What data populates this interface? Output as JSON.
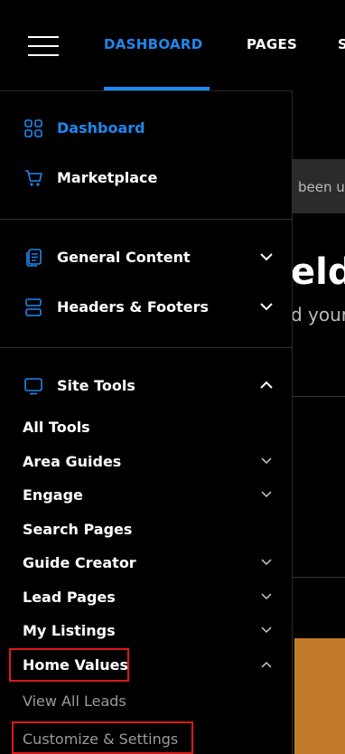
{
  "topbar": {
    "nav": [
      {
        "label": "DASHBOARD",
        "active": true
      },
      {
        "label": "PAGES",
        "active": false
      },
      {
        "label": "S",
        "active": false
      }
    ]
  },
  "page_peek": {
    "banner_text": "been u",
    "heading": "elde",
    "subheading": "d your"
  },
  "sidebar": {
    "top": [
      {
        "label": "Dashboard",
        "icon": "grid-icon",
        "active": true
      },
      {
        "label": "Marketplace",
        "icon": "cart-icon",
        "active": false
      }
    ],
    "content": [
      {
        "label": "General Content",
        "icon": "documents-icon",
        "expanded": false
      },
      {
        "label": "Headers & Footers",
        "icon": "layout-icon",
        "expanded": false
      }
    ],
    "tools": {
      "label": "Site Tools",
      "icon": "monitor-icon",
      "expanded": true
    },
    "sub_items": [
      {
        "label": "All Tools",
        "chevron": "none"
      },
      {
        "label": "Area Guides",
        "chevron": "down"
      },
      {
        "label": "Engage",
        "chevron": "down"
      },
      {
        "label": "Search Pages",
        "chevron": "none"
      },
      {
        "label": "Guide Creator",
        "chevron": "down"
      },
      {
        "label": "Lead Pages",
        "chevron": "down"
      },
      {
        "label": "My Listings",
        "chevron": "down"
      },
      {
        "label": "Home Values",
        "chevron": "up"
      }
    ],
    "nested_items": [
      {
        "label": "View All Leads"
      },
      {
        "label": "Customize & Settings"
      }
    ]
  },
  "colors": {
    "accent": "#1e88f0",
    "highlight": "#e01818",
    "background": "#000000"
  }
}
